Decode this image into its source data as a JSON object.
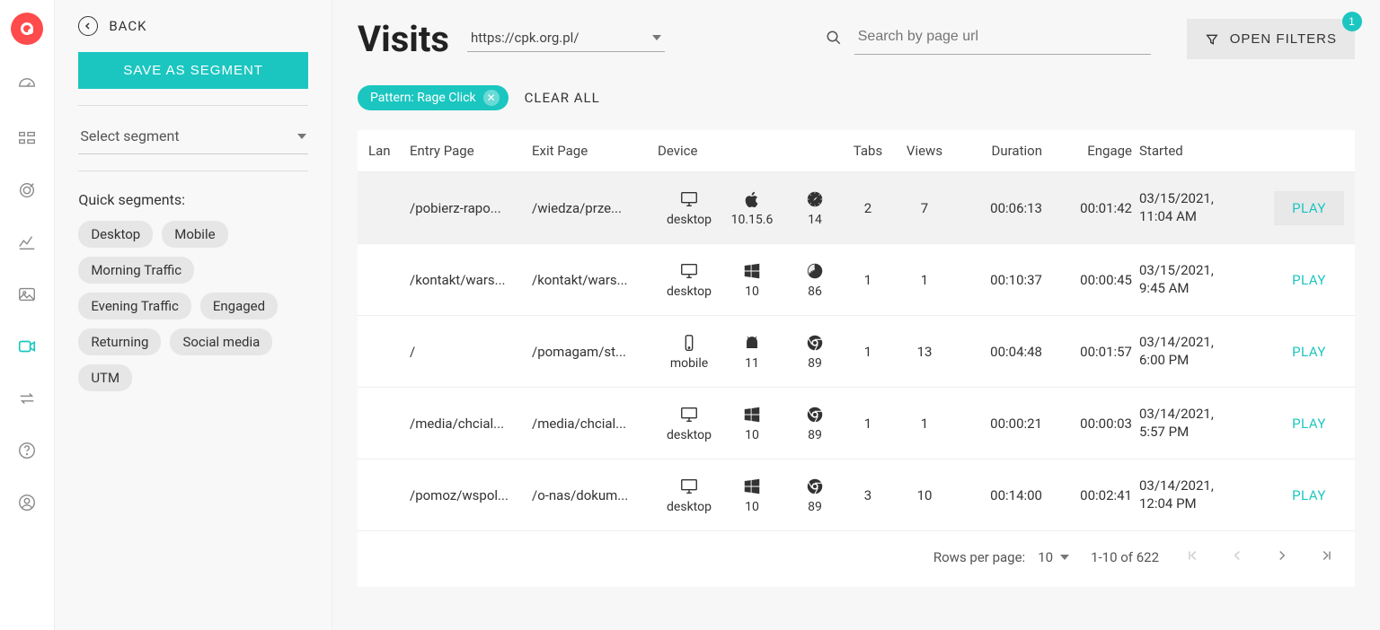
{
  "sidebar": {
    "back_label": "BACK",
    "save_segment_label": "SAVE AS SEGMENT",
    "select_segment_label": "Select segment",
    "quick_segments_label": "Quick segments:",
    "quick_segments": [
      "Desktop",
      "Mobile",
      "Morning Traffic",
      "Evening Traffic",
      "Engaged",
      "Returning",
      "Social media",
      "UTM"
    ]
  },
  "header": {
    "title": "Visits",
    "url": "https://cpk.org.pl/",
    "search_placeholder": "Search by page url",
    "open_filters_label": "OPEN FILTERS",
    "filter_badge": "1"
  },
  "filters": {
    "active_pill": "Pattern: Rage Click",
    "clear_all_label": "CLEAR ALL"
  },
  "table": {
    "columns": {
      "lan": "Lan",
      "entry": "Entry Page",
      "exit": "Exit Page",
      "device": "Device",
      "tabs": "Tabs",
      "views": "Views",
      "duration": "Duration",
      "engage": "Engage",
      "started": "Started"
    },
    "play_label": "PLAY",
    "rows": [
      {
        "entry": "/pobierz-rapo...",
        "exit": "/wiedza/prze...",
        "device_type": "desktop",
        "os_icon": "apple",
        "os": "10.15.6",
        "browser_icon": "safari",
        "browser": "14",
        "tabs": "2",
        "views": "7",
        "duration": "00:06:13",
        "engage": "00:01:42",
        "started_date": "03/15/2021,",
        "started_time": "11:04 AM",
        "selected": true
      },
      {
        "entry": "/kontakt/wars...",
        "exit": "/kontakt/wars...",
        "device_type": "desktop",
        "os_icon": "windows",
        "os": "10",
        "browser_icon": "firefox",
        "browser": "86",
        "tabs": "1",
        "views": "1",
        "duration": "00:10:37",
        "engage": "00:00:45",
        "started_date": "03/15/2021,",
        "started_time": "9:45 AM",
        "selected": false
      },
      {
        "entry": "/",
        "exit": "/pomagam/st...",
        "device_type": "mobile",
        "os_icon": "android",
        "os": "11",
        "browser_icon": "chrome",
        "browser": "89",
        "tabs": "1",
        "views": "13",
        "duration": "00:04:48",
        "engage": "00:01:57",
        "started_date": "03/14/2021,",
        "started_time": "6:00 PM",
        "selected": false
      },
      {
        "entry": "/media/chcial...",
        "exit": "/media/chcial...",
        "device_type": "desktop",
        "os_icon": "windows",
        "os": "10",
        "browser_icon": "chrome",
        "browser": "89",
        "tabs": "1",
        "views": "1",
        "duration": "00:00:21",
        "engage": "00:00:03",
        "started_date": "03/14/2021,",
        "started_time": "5:57 PM",
        "selected": false
      },
      {
        "entry": "/pomoz/wspol...",
        "exit": "/o-nas/dokum...",
        "device_type": "desktop",
        "os_icon": "windows",
        "os": "10",
        "browser_icon": "chrome",
        "browser": "89",
        "tabs": "3",
        "views": "10",
        "duration": "00:14:00",
        "engage": "00:02:41",
        "started_date": "03/14/2021,",
        "started_time": "12:04 PM",
        "selected": false
      }
    ]
  },
  "pagination": {
    "rows_per_page_label": "Rows per page:",
    "rows_per_page": "10",
    "range": "1-10 of 622"
  }
}
